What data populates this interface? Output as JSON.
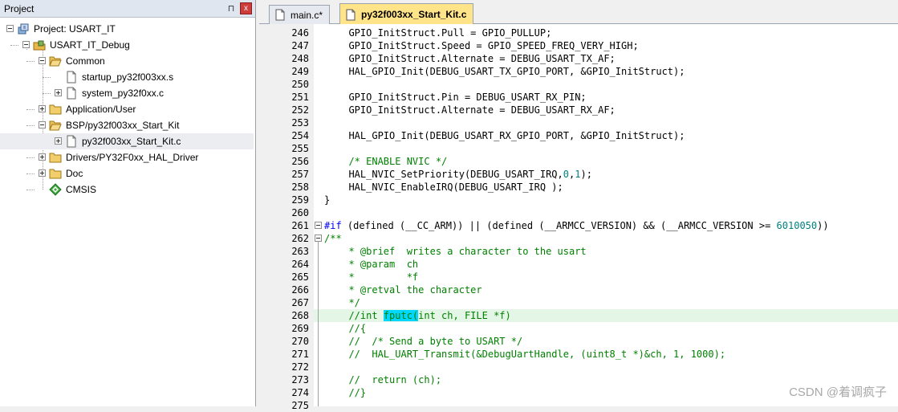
{
  "project_pane": {
    "title": "Project",
    "pin_icon": "⊓",
    "close_icon": "x",
    "tree": [
      {
        "label": "Project: USART_IT",
        "icon": "project-icon",
        "expander": "minus"
      },
      {
        "label": "USART_IT_Debug",
        "icon": "target-icon",
        "expander": "minus"
      },
      {
        "label": "Common",
        "icon": "folder-open-icon",
        "expander": "minus"
      },
      {
        "label": "startup_py32f003xx.s",
        "icon": "file-icon",
        "expander": "none"
      },
      {
        "label": "system_py32f0xx.c",
        "icon": "file-icon",
        "expander": "plus"
      },
      {
        "label": "Application/User",
        "icon": "folder-icon",
        "expander": "plus"
      },
      {
        "label": "BSP/py32f003xx_Start_Kit",
        "icon": "folder-open-icon",
        "expander": "minus"
      },
      {
        "label": "py32f003xx_Start_Kit.c",
        "icon": "file-icon",
        "expander": "plus"
      },
      {
        "label": "Drivers/PY32F0xx_HAL_Driver",
        "icon": "folder-icon",
        "expander": "plus"
      },
      {
        "label": "Doc",
        "icon": "folder-icon",
        "expander": "plus"
      },
      {
        "label": "CMSIS",
        "icon": "cmsis-icon",
        "expander": "none"
      }
    ]
  },
  "editor": {
    "tabs": [
      {
        "label": "main.c*",
        "active": false
      },
      {
        "label": "py32f003xx_Start_Kit.c",
        "active": true
      }
    ],
    "line_numbers": [
      "246",
      "247",
      "248",
      "249",
      "250",
      "251",
      "252",
      "253",
      "254",
      "255",
      "256",
      "257",
      "258",
      "259",
      "260",
      "261",
      "262",
      "263",
      "264",
      "265",
      "266",
      "267",
      "268",
      "269",
      "270",
      "271",
      "272",
      "273",
      "274",
      "275"
    ],
    "lines": [
      "  GPIO_InitStruct.Pull = GPIO_PULLUP;",
      "  GPIO_InitStruct.Speed = GPIO_SPEED_FREQ_VERY_HIGH;",
      "  GPIO_InitStruct.Alternate = DEBUG_USART_TX_AF;",
      "  HAL_GPIO_Init(DEBUG_USART_TX_GPIO_PORT, &GPIO_InitStruct);",
      "",
      "  GPIO_InitStruct.Pin = DEBUG_USART_RX_PIN;",
      "  GPIO_InitStruct.Alternate = DEBUG_USART_RX_AF;",
      "",
      "  HAL_GPIO_Init(DEBUG_USART_RX_GPIO_PORT, &GPIO_InitStruct);",
      "",
      "  /* ENABLE NVIC */",
      "  HAL_NVIC_SetPriority(DEBUG_USART_IRQ,0,1);",
      "  HAL_NVIC_EnableIRQ(DEBUG_USART_IRQ );",
      "}",
      "",
      "#if (defined (__CC_ARM)) || (defined (__ARMCC_VERSION) && (__ARMCC_VERSION >= 6010050))",
      "/**",
      "  * @brief  writes a character to the usart",
      "  * @param  ch",
      "  *         *f",
      "  * @retval the character",
      "  */",
      "  //int fputc(int ch, FILE *f)",
      "  //{",
      "  //  /* Send a byte to USART */",
      "  //  HAL_UART_Transmit(&DebugUartHandle, (uint8_t *)&ch, 1, 1000);",
      "",
      "  //  return (ch);",
      "  //}",
      ""
    ],
    "highlighted_line": "268",
    "selected_word": "fputc("
  },
  "watermark": "CSDN @着调疯子"
}
